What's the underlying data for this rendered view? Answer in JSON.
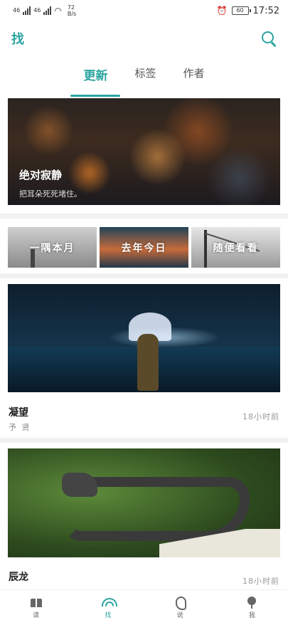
{
  "status_bar": {
    "network_1": "46",
    "network_2": "46",
    "speed_value": "72",
    "speed_unit": "B/s",
    "battery": "60",
    "time": "17:52"
  },
  "header": {
    "title": "找",
    "search_icon": "search-icon"
  },
  "tabs": [
    {
      "label": "更新",
      "active": true
    },
    {
      "label": "标签",
      "active": false
    },
    {
      "label": "作者",
      "active": false
    }
  ],
  "featured": {
    "title": "绝对寂静",
    "subtitle": "把耳朵死死堵住。"
  },
  "categories": [
    {
      "label": "一隅本月"
    },
    {
      "label": "去年今日"
    },
    {
      "label": "随便看看"
    }
  ],
  "stories": [
    {
      "title": "凝望",
      "author": "予 贤",
      "time": "18小时前"
    },
    {
      "title": "辰龙",
      "author": "",
      "time": "18小时前"
    }
  ],
  "bottom_nav": [
    {
      "label": "读",
      "icon": "book-icon",
      "active": false
    },
    {
      "label": "找",
      "icon": "arc-icon",
      "active": true
    },
    {
      "label": "说",
      "icon": "ear-icon",
      "active": false
    },
    {
      "label": "我",
      "icon": "tree-icon",
      "active": false
    }
  ],
  "colors": {
    "accent": "#2aa5a0"
  }
}
